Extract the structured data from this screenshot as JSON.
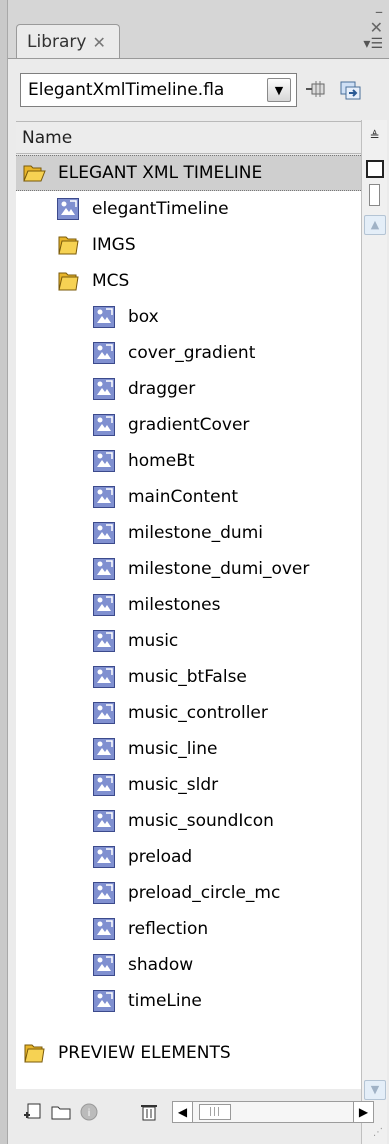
{
  "panel": {
    "tab_label": "Library",
    "file_name": "ElegantXmlTimeline.fla",
    "column_name": "Name"
  },
  "items": [
    {
      "label": "ELEGANT XML TIMELINE",
      "type": "folder-open",
      "level": 0,
      "selected": true
    },
    {
      "label": "elegantTimeline",
      "type": "movieclip",
      "level": 1
    },
    {
      "label": "IMGS",
      "type": "folder",
      "level": 1
    },
    {
      "label": "MCS",
      "type": "folder",
      "level": 1
    },
    {
      "label": "box",
      "type": "movieclip",
      "level": 2
    },
    {
      "label": "cover_gradient",
      "type": "movieclip",
      "level": 2
    },
    {
      "label": "dragger",
      "type": "movieclip",
      "level": 2
    },
    {
      "label": "gradientCover",
      "type": "movieclip",
      "level": 2
    },
    {
      "label": "homeBt",
      "type": "movieclip",
      "level": 2
    },
    {
      "label": "mainContent",
      "type": "movieclip",
      "level": 2
    },
    {
      "label": "milestone_dumi",
      "type": "movieclip",
      "level": 2
    },
    {
      "label": "milestone_dumi_over",
      "type": "movieclip",
      "level": 2
    },
    {
      "label": "milestones",
      "type": "movieclip",
      "level": 2
    },
    {
      "label": "music",
      "type": "movieclip",
      "level": 2
    },
    {
      "label": "music_btFalse",
      "type": "movieclip",
      "level": 2
    },
    {
      "label": "music_controller",
      "type": "movieclip",
      "level": 2
    },
    {
      "label": "music_line",
      "type": "movieclip",
      "level": 2
    },
    {
      "label": "music_sldr",
      "type": "movieclip",
      "level": 2
    },
    {
      "label": "music_soundIcon",
      "type": "movieclip",
      "level": 2
    },
    {
      "label": "preload",
      "type": "movieclip",
      "level": 2
    },
    {
      "label": "preload_circle_mc",
      "type": "movieclip",
      "level": 2
    },
    {
      "label": "reflection",
      "type": "movieclip",
      "level": 2
    },
    {
      "label": "shadow",
      "type": "movieclip",
      "level": 2
    },
    {
      "label": "timeLine",
      "type": "movieclip",
      "level": 2
    },
    {
      "label": "PREVIEW ELEMENTS",
      "type": "folder",
      "level": 0
    }
  ],
  "colors": {
    "panel_bg": "#ebebeb",
    "list_bg": "#ffffff",
    "selected_row": "#cfcfcf",
    "folder_yellow": "#f3c63a",
    "symbol_blue": "#6f7fc4"
  }
}
